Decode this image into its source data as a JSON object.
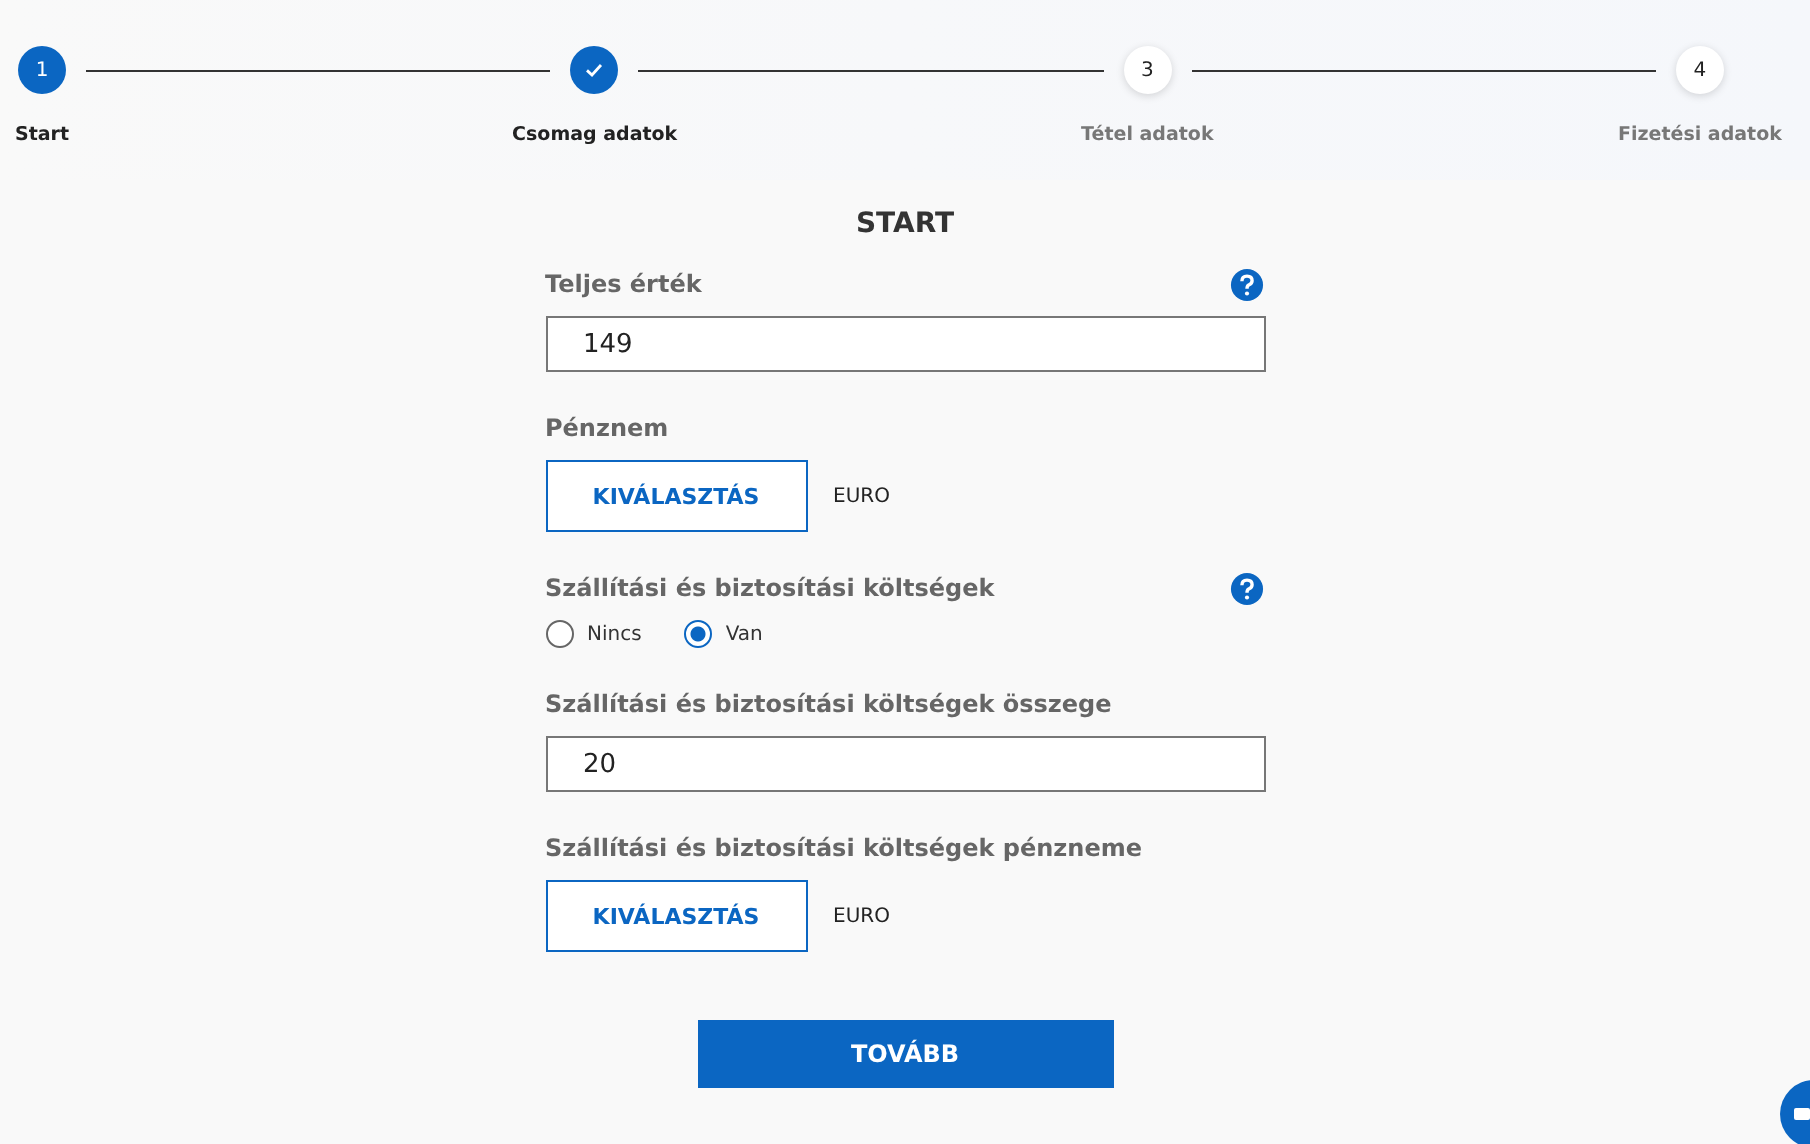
{
  "steps": [
    {
      "number": "1",
      "label": "Start",
      "current": true,
      "done": false
    },
    {
      "label": "Csomag adatok",
      "current": false,
      "done": true
    },
    {
      "number": "3",
      "label": "Tétel adatok",
      "current": false,
      "done": false
    },
    {
      "number": "4",
      "label": "Fizetési adatok",
      "current": false,
      "done": false
    }
  ],
  "title": "START",
  "fields": [
    {
      "kind": "input",
      "label": "Teljes érték",
      "help": true,
      "value": "149"
    },
    {
      "kind": "select",
      "label": "Pénznem",
      "button": "KIVÁLASZTÁS",
      "value": "EURO"
    },
    {
      "kind": "radio",
      "label": "Szállítási és biztosítási költségek",
      "help": true,
      "options": [
        {
          "label": "Nincs",
          "selected": false
        },
        {
          "label": "Van",
          "selected": true
        }
      ]
    },
    {
      "kind": "input",
      "label": "Szállítási és biztosítási költségek összege",
      "value": "20"
    },
    {
      "kind": "select",
      "label": "Szállítási és biztosítási költségek pénzneme",
      "button": "KIVÁLASZTÁS",
      "value": "EURO"
    }
  ],
  "submit": "TOVÁBB"
}
